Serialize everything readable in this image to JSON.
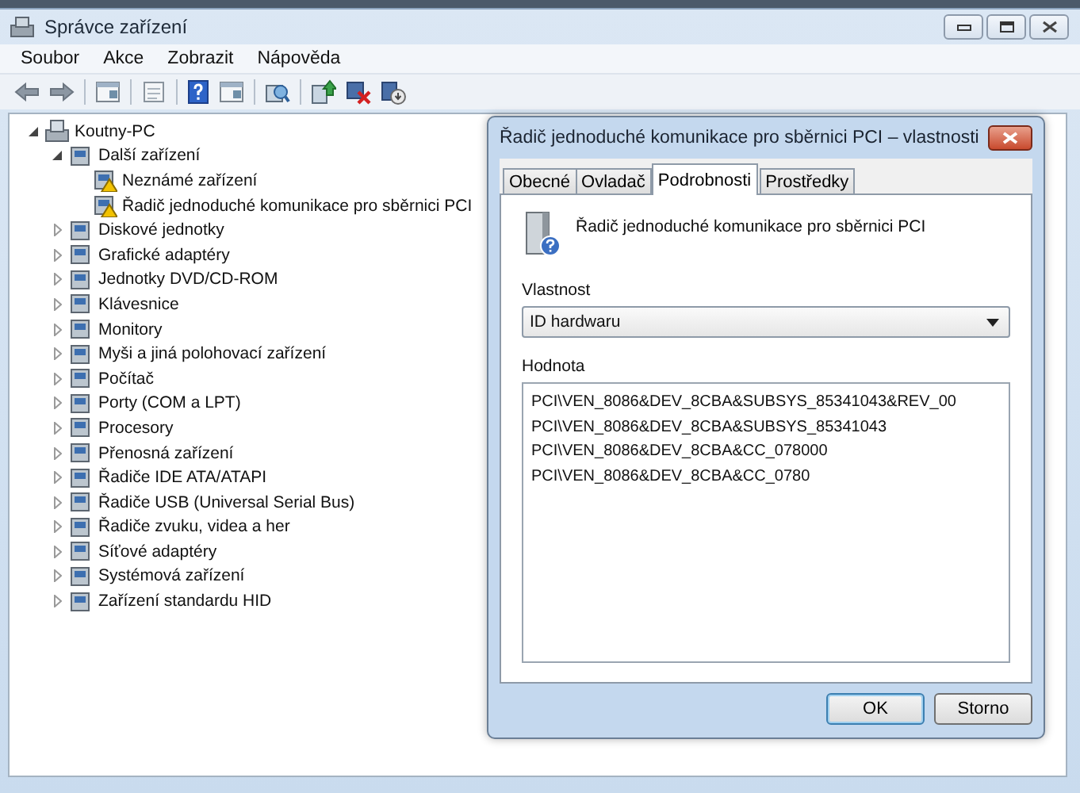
{
  "window": {
    "title": "Správce zařízení",
    "menu": [
      "Soubor",
      "Akce",
      "Zobrazit",
      "Nápověda"
    ]
  },
  "toolbar": [
    {
      "kind": "back"
    },
    {
      "kind": "forward"
    },
    {
      "kind": "sep"
    },
    {
      "kind": "panel"
    },
    {
      "kind": "sep"
    },
    {
      "kind": "props"
    },
    {
      "kind": "sep"
    },
    {
      "kind": "help"
    },
    {
      "kind": "panel"
    },
    {
      "kind": "sep"
    },
    {
      "kind": "scan"
    },
    {
      "kind": "sep"
    },
    {
      "kind": "update"
    },
    {
      "kind": "disable"
    },
    {
      "kind": "uninstall"
    }
  ],
  "tree": [
    {
      "label": "Koutny-PC",
      "expanded": true,
      "children": [
        {
          "label": "Další zařízení",
          "expanded": true,
          "children": [
            {
              "label": "Neznámé zařízení",
              "warning": true
            },
            {
              "label": "Řadič jednoduché komunikace pro sběrnici PCI",
              "warning": true
            }
          ]
        },
        {
          "label": "Diskové jednotky",
          "expanded": false
        },
        {
          "label": "Grafické adaptéry",
          "expanded": false
        },
        {
          "label": "Jednotky DVD/CD-ROM",
          "expanded": false
        },
        {
          "label": "Klávesnice",
          "expanded": false
        },
        {
          "label": "Monitory",
          "expanded": false
        },
        {
          "label": "Myši a jiná polohovací zařízení",
          "expanded": false
        },
        {
          "label": "Počítač",
          "expanded": false
        },
        {
          "label": "Porty (COM a LPT)",
          "expanded": false
        },
        {
          "label": "Procesory",
          "expanded": false
        },
        {
          "label": "Přenosná zařízení",
          "expanded": false
        },
        {
          "label": "Řadiče IDE ATA/ATAPI",
          "expanded": false
        },
        {
          "label": "Řadiče USB (Universal Serial Bus)",
          "expanded": false
        },
        {
          "label": "Řadiče zvuku, videa a her",
          "expanded": false
        },
        {
          "label": "Síťové adaptéry",
          "expanded": false
        },
        {
          "label": "Systémová zařízení",
          "expanded": false
        },
        {
          "label": "Zařízení standardu HID",
          "expanded": false
        }
      ]
    }
  ],
  "dialog": {
    "title": "Řadič jednoduché komunikace pro sběrnici PCI – vlastnosti",
    "tabs": [
      {
        "label": "Obecné",
        "selected": false
      },
      {
        "label": "Ovladač",
        "selected": false
      },
      {
        "label": "Podrobnosti",
        "selected": true
      },
      {
        "label": "Prostředky",
        "selected": false
      }
    ],
    "device_name": "Řadič jednoduché komunikace pro sběrnici PCI",
    "property_label": "Vlastnost",
    "property_value": "ID hardwaru",
    "value_label": "Hodnota",
    "values": [
      "PCI\\VEN_8086&DEV_8CBA&SUBSYS_85341043&REV_00",
      "PCI\\VEN_8086&DEV_8CBA&SUBSYS_85341043",
      "PCI\\VEN_8086&DEV_8CBA&CC_078000",
      "PCI\\VEN_8086&DEV_8CBA&CC_0780"
    ],
    "buttons": [
      {
        "label": "OK",
        "default": true
      },
      {
        "label": "Storno",
        "default": false
      }
    ]
  }
}
